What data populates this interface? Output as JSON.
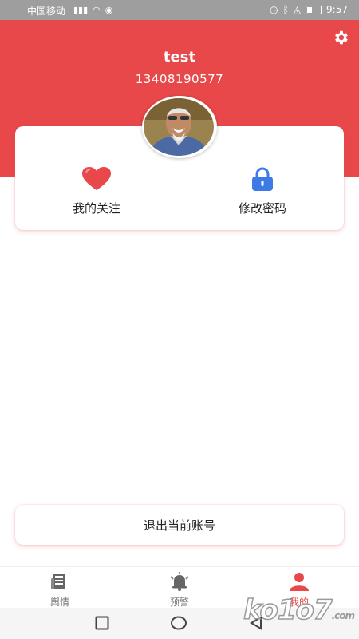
{
  "status_bar": {
    "carrier": "中国移动",
    "time": "9:57"
  },
  "header": {
    "username": "test",
    "phone": "13408190577",
    "settings_icon": "gear-icon",
    "background_color": "#e8484a"
  },
  "card": {
    "items": [
      {
        "label": "我的关注",
        "icon": "heart-icon",
        "color": "#e8484a"
      },
      {
        "label": "修改密码",
        "icon": "lock-icon",
        "color": "#3d7ae8"
      }
    ]
  },
  "logout": {
    "label": "退出当前账号"
  },
  "tabbar": {
    "tabs": [
      {
        "label": "舆情",
        "icon": "newspaper-icon",
        "active": false
      },
      {
        "label": "预警",
        "icon": "bell-icon",
        "active": false
      },
      {
        "label": "我的",
        "icon": "person-icon",
        "active": true
      }
    ]
  },
  "watermark": {
    "text": "ko1o7",
    "suffix": ".com"
  }
}
